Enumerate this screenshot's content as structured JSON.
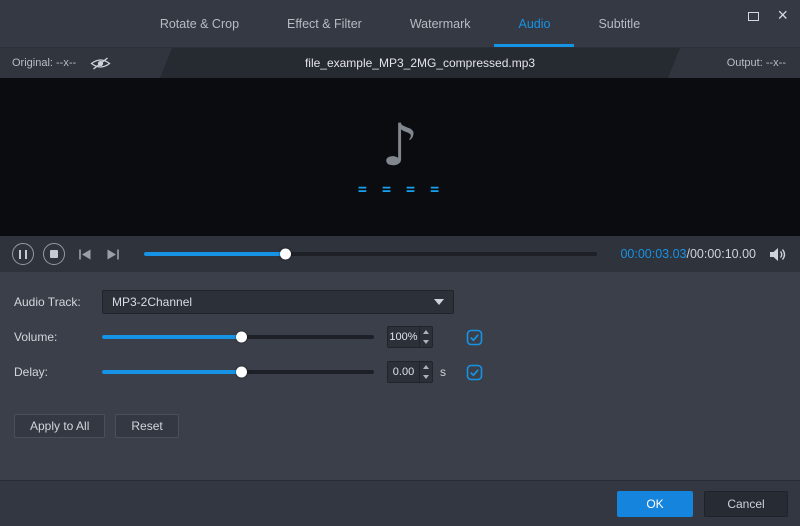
{
  "window": {
    "close_icon": "×"
  },
  "tabs": [
    {
      "label": "Rotate & Crop"
    },
    {
      "label": "Effect & Filter"
    },
    {
      "label": "Watermark"
    },
    {
      "label": "Audio"
    },
    {
      "label": "Subtitle"
    }
  ],
  "active_tab": "Audio",
  "info_bar": {
    "original_label": "Original: --x--",
    "filename": "file_example_MP3_2MG_compressed.mp3",
    "output_label": "Output: --x--"
  },
  "preview": {
    "note_icon": "♪",
    "dashes": "= = = ="
  },
  "transport": {
    "progress_percent": 31,
    "time_current": "00:00:03.03",
    "time_total": "/00:00:10.00"
  },
  "panel": {
    "audio_track": {
      "label": "Audio Track:",
      "value": "MP3-2Channel"
    },
    "volume": {
      "label": "Volume:",
      "value": "100%",
      "slider_percent": 51
    },
    "delay": {
      "label": "Delay:",
      "value": "0.00",
      "unit": "s",
      "slider_percent": 51
    },
    "apply_all_label": "Apply to All",
    "reset_label": "Reset"
  },
  "footer": {
    "ok_label": "OK",
    "cancel_label": "Cancel"
  },
  "colors": {
    "accent": "#1793e6",
    "preview_bg": "#0a0c10",
    "ok_button": "#1584dc"
  }
}
